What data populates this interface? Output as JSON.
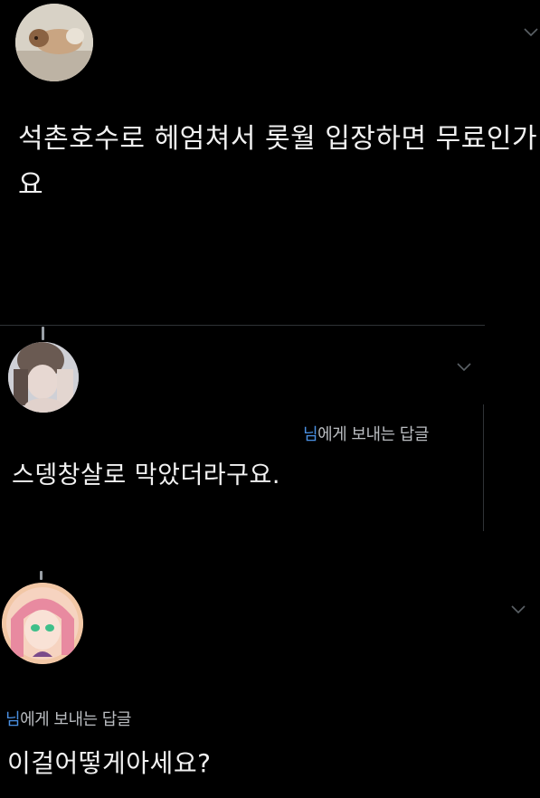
{
  "colors": {
    "background": "#000000",
    "text": "#f1f1f1",
    "secondary_text": "#b9bcc0",
    "mention": "#4a90e2",
    "divider": "#2f3336"
  },
  "tweets": [
    {
      "avatar": "dog-avatar",
      "text": "석촌호수로 헤엄쳐서 롯월 입장하면 무료인가요"
    },
    {
      "avatar": "person-avatar",
      "reply_to_handle": "님",
      "reply_suffix": "에게 보내는 답글",
      "text": "스뎅창살로 막았더라구요."
    },
    {
      "avatar": "anime-avatar",
      "reply_to_handle": "님",
      "reply_suffix": "에게 보내는 답글",
      "text": "이걸어떻게아세요?"
    }
  ],
  "icons": {
    "more_menu": "chevron-down-icon"
  }
}
